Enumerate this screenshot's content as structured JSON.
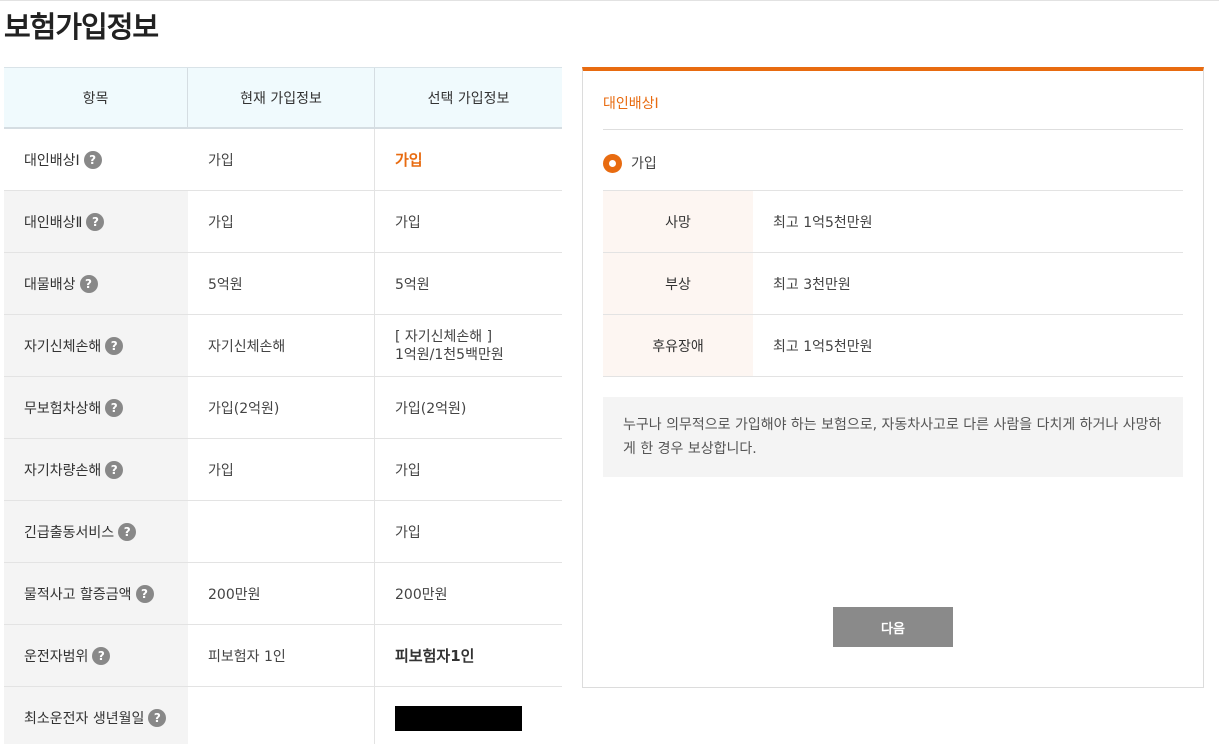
{
  "page": {
    "title": "보험가입정보"
  },
  "table": {
    "headers": [
      "항목",
      "현재 가입정보",
      "선택 가입정보"
    ],
    "rows": [
      {
        "item": "대인배상Ⅰ",
        "current": "가입",
        "selected": "가입"
      },
      {
        "item": "대인배상Ⅱ",
        "current": "가입",
        "selected": "가입"
      },
      {
        "item": "대물배상",
        "current": "5억원",
        "selected": "5억원"
      },
      {
        "item": "자기신체손해",
        "current": "자기신체손해",
        "selected_line1": "[ 자기신체손해 ]",
        "selected_line2": "1억원/1천5백만원"
      },
      {
        "item": "무보험차상해",
        "current": "가입(2억원)",
        "selected": "가입(2억원)"
      },
      {
        "item": "자기차량손해",
        "current": "가입",
        "selected": "가입"
      },
      {
        "item": "긴급출동서비스",
        "current": "",
        "selected": "가입"
      },
      {
        "item": "물적사고 할증금액",
        "current": "200만원",
        "selected": "200만원"
      },
      {
        "item": "운전자범위",
        "current": "피보험자 1인",
        "selected": "피보험자1인"
      },
      {
        "item": "최소운전자 생년월일",
        "current": "",
        "selected": ""
      }
    ],
    "help_glyph": "?"
  },
  "panel": {
    "title": "대인배상Ⅰ",
    "option_label": "가입",
    "coverage": [
      {
        "label": "사망",
        "value": "최고 1억5천만원"
      },
      {
        "label": "부상",
        "value": "최고 3천만원"
      },
      {
        "label": "후유장애",
        "value": "최고 1억5천만원"
      }
    ],
    "description": "누구나 의무적으로 가입해야 하는 보험으로, 자동차사고로 다른 사람을 다치게 하거나 사망하게 한 경우 보상합니다.",
    "next_label": "다음"
  },
  "colors": {
    "accent": "#e86b10",
    "header_bg": "#f0fafd",
    "button_bg": "#8a8a8a"
  },
  "icons": {
    "help": "question-circle-icon",
    "radio": "radio-selected-icon"
  }
}
